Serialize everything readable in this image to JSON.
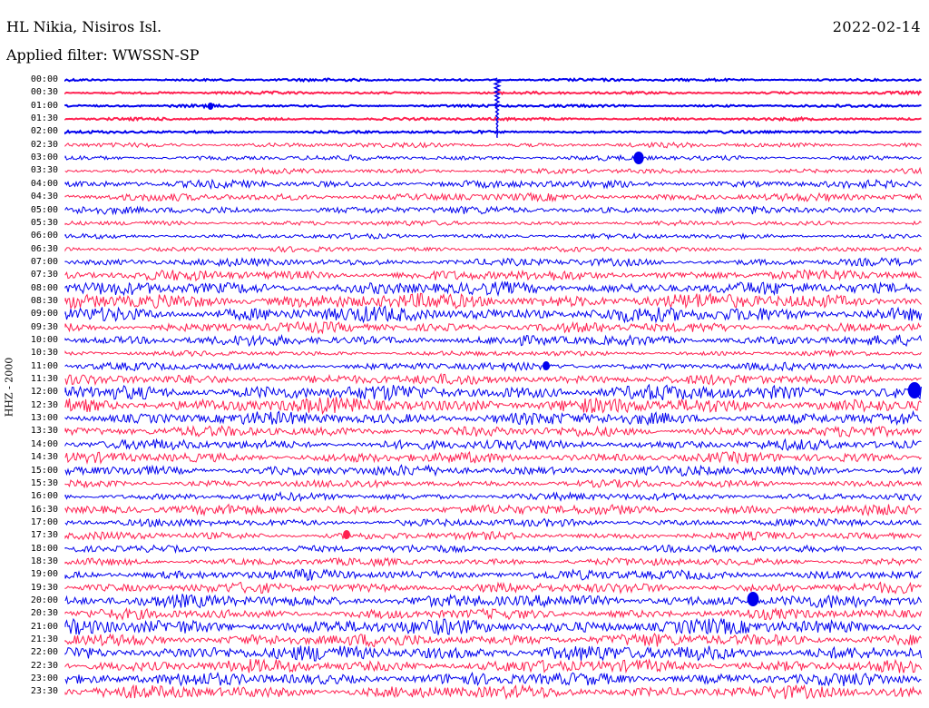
{
  "header": {
    "station": "HL Nikia, Nisiros Isl.",
    "date": "2022-02-14",
    "filter": "Applied filter: WWSSN-SP",
    "channel": "HHZ - 2000"
  },
  "colors": {
    "odd": "#0000ee",
    "even": "#ff2050"
  },
  "rows": [
    {
      "time": "00:00",
      "color": "blue",
      "amp": 1
    },
    {
      "time": "00:30",
      "color": "red",
      "amp": 1
    },
    {
      "time": "01:00",
      "color": "blue",
      "amp": 1
    },
    {
      "time": "01:30",
      "color": "red",
      "amp": 1
    },
    {
      "time": "02:00",
      "color": "blue",
      "amp": 1
    },
    {
      "time": "02:30",
      "color": "red",
      "amp": 2
    },
    {
      "time": "03:00",
      "color": "blue",
      "amp": 2
    },
    {
      "time": "03:30",
      "color": "red",
      "amp": 2
    },
    {
      "time": "04:00",
      "color": "blue",
      "amp": 3
    },
    {
      "time": "04:30",
      "color": "red",
      "amp": 3
    },
    {
      "time": "05:00",
      "color": "blue",
      "amp": 3
    },
    {
      "time": "05:30",
      "color": "red",
      "amp": 2
    },
    {
      "time": "06:00",
      "color": "blue",
      "amp": 2
    },
    {
      "time": "06:30",
      "color": "red",
      "amp": 2
    },
    {
      "time": "07:00",
      "color": "blue",
      "amp": 3
    },
    {
      "time": "07:30",
      "color": "red",
      "amp": 4
    },
    {
      "time": "08:00",
      "color": "blue",
      "amp": 5
    },
    {
      "time": "08:30",
      "color": "red",
      "amp": 6
    },
    {
      "time": "09:00",
      "color": "blue",
      "amp": 6
    },
    {
      "time": "09:30",
      "color": "red",
      "amp": 4
    },
    {
      "time": "10:00",
      "color": "blue",
      "amp": 4
    },
    {
      "time": "10:30",
      "color": "red",
      "amp": 2
    },
    {
      "time": "11:00",
      "color": "blue",
      "amp": 3
    },
    {
      "time": "11:30",
      "color": "red",
      "amp": 4
    },
    {
      "time": "12:00",
      "color": "blue",
      "amp": 6
    },
    {
      "time": "12:30",
      "color": "red",
      "amp": 6
    },
    {
      "time": "13:00",
      "color": "blue",
      "amp": 5
    },
    {
      "time": "13:30",
      "color": "red",
      "amp": 4
    },
    {
      "time": "14:00",
      "color": "blue",
      "amp": 4
    },
    {
      "time": "14:30",
      "color": "red",
      "amp": 4
    },
    {
      "time": "15:00",
      "color": "blue",
      "amp": 4
    },
    {
      "time": "15:30",
      "color": "red",
      "amp": 3
    },
    {
      "time": "16:00",
      "color": "blue",
      "amp": 3
    },
    {
      "time": "16:30",
      "color": "red",
      "amp": 4
    },
    {
      "time": "17:00",
      "color": "blue",
      "amp": 3
    },
    {
      "time": "17:30",
      "color": "red",
      "amp": 3
    },
    {
      "time": "18:00",
      "color": "blue",
      "amp": 3
    },
    {
      "time": "18:30",
      "color": "red",
      "amp": 3
    },
    {
      "time": "19:00",
      "color": "blue",
      "amp": 4
    },
    {
      "time": "19:30",
      "color": "red",
      "amp": 4
    },
    {
      "time": "20:00",
      "color": "blue",
      "amp": 5
    },
    {
      "time": "20:30",
      "color": "red",
      "amp": 4
    },
    {
      "time": "21:00",
      "color": "blue",
      "amp": 6
    },
    {
      "time": "21:30",
      "color": "red",
      "amp": 5
    },
    {
      "time": "22:00",
      "color": "blue",
      "amp": 6
    },
    {
      "time": "22:30",
      "color": "red",
      "amp": 5
    },
    {
      "time": "23:00",
      "color": "blue",
      "amp": 5
    },
    {
      "time": "23:30",
      "color": "red",
      "amp": 5
    }
  ]
}
